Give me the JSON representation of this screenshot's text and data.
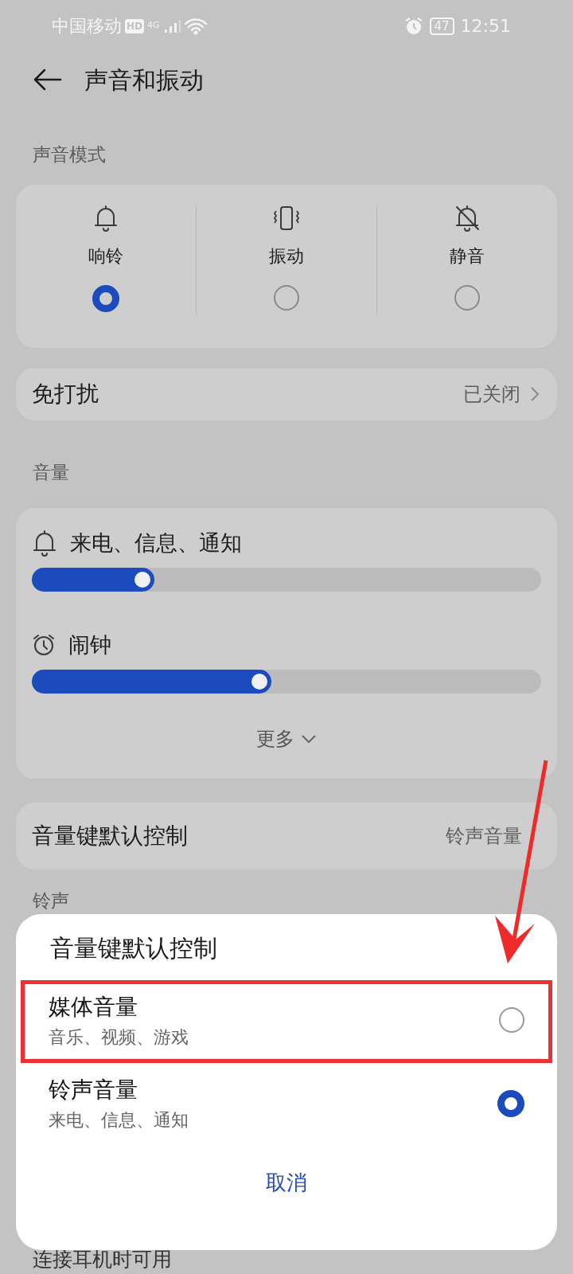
{
  "status_bar": {
    "carrier": "中国移动",
    "hd": "HD",
    "network": "4G",
    "battery": "47",
    "time": "12:51"
  },
  "header": {
    "title": "声音和振动"
  },
  "sound_mode": {
    "heading": "声音模式",
    "options": [
      {
        "label": "响铃",
        "selected": true
      },
      {
        "label": "振动",
        "selected": false
      },
      {
        "label": "静音",
        "selected": false
      }
    ]
  },
  "do_not_disturb": {
    "label": "免打扰",
    "value": "已关闭"
  },
  "volume": {
    "heading": "音量",
    "sliders": [
      {
        "label": "来电、信息、通知",
        "level": 0.24
      },
      {
        "label": "闹钟",
        "level": 0.47
      }
    ],
    "more": "更多"
  },
  "volume_key": {
    "label": "音量键默认控制",
    "value": "铃声音量"
  },
  "ringtone": {
    "heading": "铃声"
  },
  "footer_text": "连接耳机时可用",
  "dialog": {
    "title": "音量键默认控制",
    "options": [
      {
        "label": "媒体音量",
        "description": "音乐、视频、游戏",
        "selected": false,
        "highlighted": true
      },
      {
        "label": "铃声音量",
        "description": "来电、信息、通知",
        "selected": true,
        "highlighted": false
      }
    ],
    "cancel": "取消"
  }
}
